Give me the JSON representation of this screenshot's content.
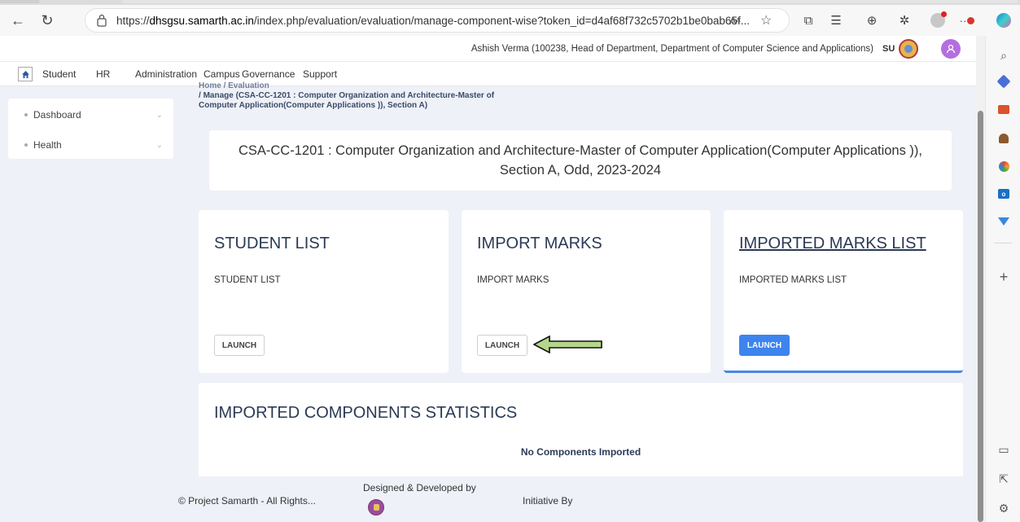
{
  "browser": {
    "url_prefix": "https://",
    "url_host": "dhsgsu.samarth.ac.in",
    "url_path": "/index.php/evaluation/evaluation/manage-component-wise?token_id=d4af68f732c5702b1be0bab65f...",
    "read_aloud_label": "Aᵃ",
    "notification_dots": "··"
  },
  "userbar": {
    "user_info": "Ashish Verma (100238, Head of Department, Department of Computer Science and Applications)",
    "university_code": "SU"
  },
  "navbar": {
    "items": [
      "Student",
      "HR",
      "Administration",
      "Campus",
      "Governance",
      "Support"
    ]
  },
  "breadcrumb": {
    "home": "Home",
    "separator1": "/",
    "evaluation": "Evaluation",
    "separator2": "/",
    "current_line1": "Manage (CSA-CC-1201 : Computer Organization and Architecture-Master of",
    "current_line2": "Computer Application(Computer Applications )), Section A)"
  },
  "sidebar": {
    "items": [
      {
        "label": "Dashboard"
      },
      {
        "label": "Health"
      }
    ]
  },
  "course": {
    "title_line1": "CSA-CC-1201 : Computer Organization and Architecture-Master of Computer Application(Computer Applications )),",
    "title_line2": "Section A, Odd, 2023-2024"
  },
  "cards": [
    {
      "title": "STUDENT LIST",
      "subtitle": "STUDENT LIST",
      "button": "LAUNCH"
    },
    {
      "title": "IMPORT MARKS",
      "subtitle": "IMPORT MARKS",
      "button": "LAUNCH"
    },
    {
      "title": "IMPORTED MARKS LIST",
      "subtitle": "IMPORTED MARKS LIST",
      "button": "LAUNCH"
    }
  ],
  "stats": {
    "title": "IMPORTED COMPONENTS STATISTICS",
    "empty_message": "No Components Imported"
  },
  "footer": {
    "copyright": "© Project Samarth - All Rights...",
    "designed_by": "Designed & Developed by",
    "initiative_by": "Initiative By"
  },
  "colors": {
    "accent": "#3d84ee",
    "page_bg": "#eef1f7",
    "arrow_fill": "#b5d68a"
  }
}
